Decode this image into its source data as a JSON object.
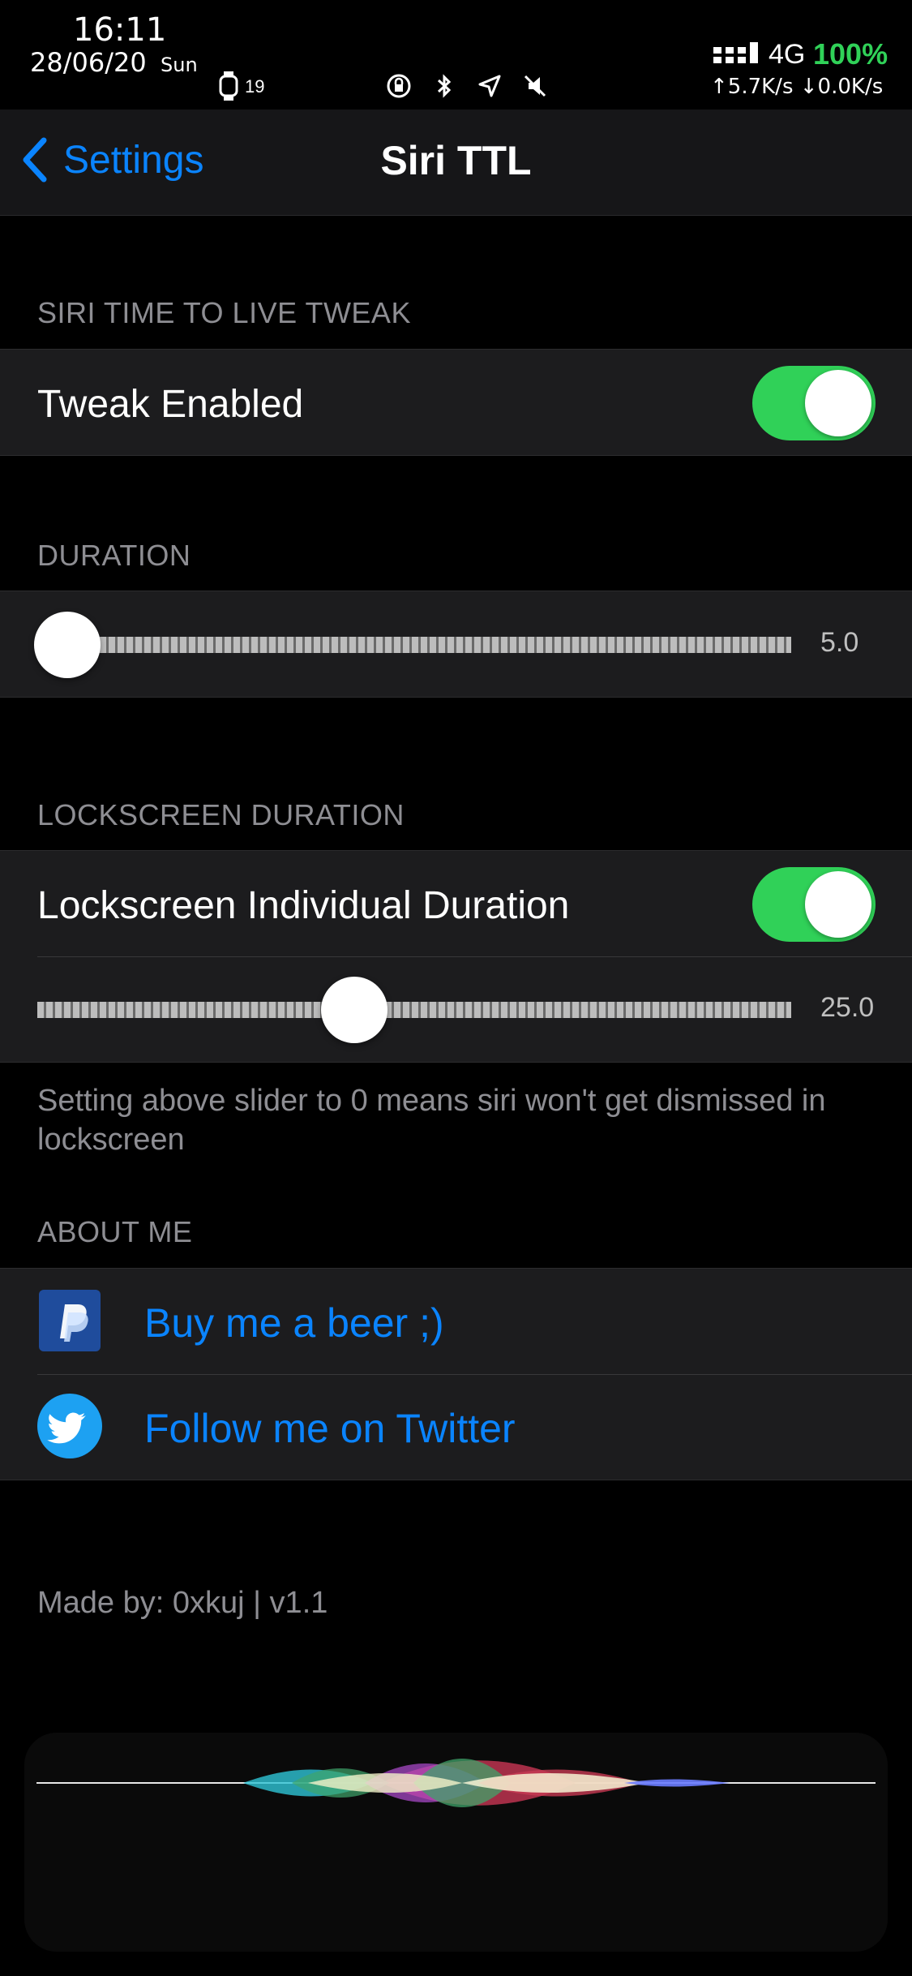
{
  "status_bar": {
    "time": "16:11",
    "date": "28/06/20",
    "day": "Sun",
    "watch_battery": "19",
    "network": "4G",
    "battery": "100%",
    "speed": "↑5.7K/s ↓0.0K/s",
    "icons": [
      "orientation-lock-icon",
      "bluetooth-icon",
      "location-icon",
      "mute-icon"
    ]
  },
  "nav": {
    "back_label": "Settings",
    "title": "Siri TTL"
  },
  "sections": {
    "tweak": {
      "header": "SIRI TIME TO LIVE TWEAK",
      "enabled_label": "Tweak Enabled",
      "enabled": true
    },
    "duration": {
      "header": "DURATION",
      "value_label": "5.0",
      "value": 5.0,
      "fraction": 0.04
    },
    "lockscreen": {
      "header": "LOCKSCREEN DURATION",
      "toggle_label": "Lockscreen Individual Duration",
      "enabled": true,
      "value_label": "25.0",
      "value": 25.0,
      "fraction": 0.42,
      "footer": "Setting above slider to 0 means siri won't get dismissed in lockscreen"
    },
    "about": {
      "header": "ABOUT ME",
      "items": [
        {
          "label": "Buy me a beer ;)",
          "icon": "paypal-icon"
        },
        {
          "label": "Follow me on Twitter",
          "icon": "twitter-icon"
        }
      ]
    }
  },
  "made_by": "Made by: 0xkuj | v1.1",
  "colors": {
    "accent": "#0a84ff",
    "toggle_on": "#30d158",
    "background": "#000000",
    "cell_bg": "#1c1c1e",
    "secondary_text": "#8e8e93"
  }
}
